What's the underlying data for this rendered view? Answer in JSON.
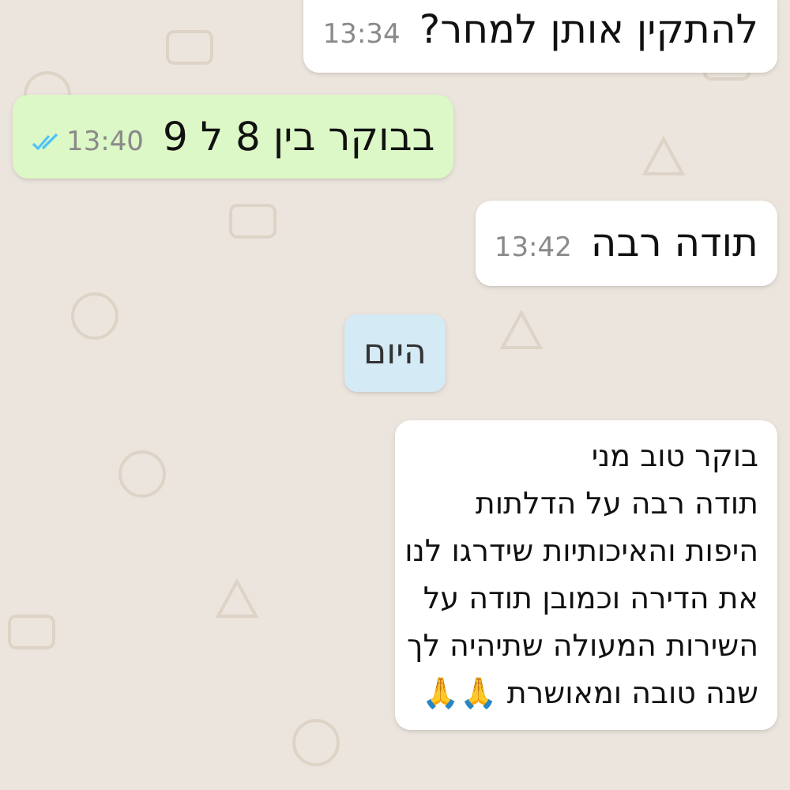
{
  "messages": [
    {
      "kind": "incoming",
      "text": "להתקין אותן למחר?",
      "time": "13:34"
    },
    {
      "kind": "outgoing",
      "text": "בבוקר בין 8 ל 9",
      "time": "13:40",
      "read": true
    },
    {
      "kind": "incoming",
      "text": "תודה רבה",
      "time": "13:42"
    },
    {
      "kind": "day",
      "text": "היום"
    },
    {
      "kind": "incoming",
      "text": "בוקר טוב מני\nתודה רבה על הדלתות\nהיפות והאיכותיות שידרגו לנו\nאת הדירה וכמובן תודה על\nהשירות המעולה שתיהיה לך\nשנה טובה ומאושרת 🙏🙏"
    }
  ]
}
